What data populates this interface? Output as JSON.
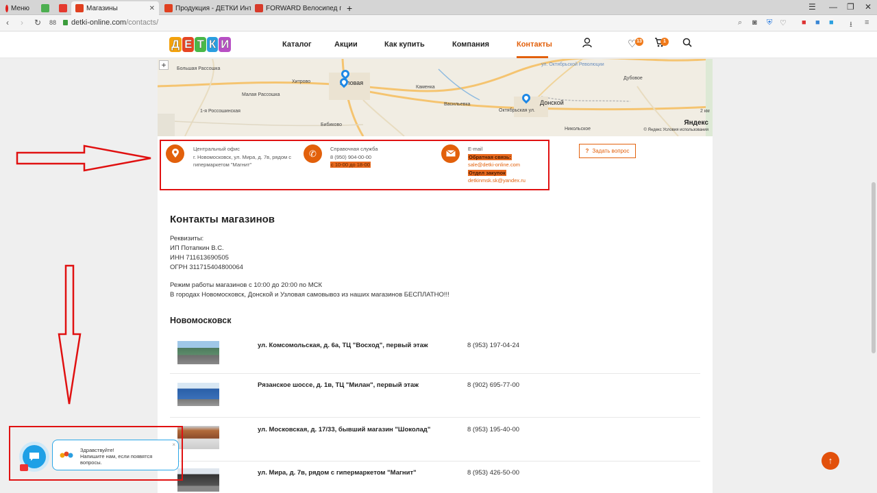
{
  "browser": {
    "tabs": [
      {
        "label": "Меню"
      },
      {
        "label": ""
      },
      {
        "label": ""
      },
      {
        "label": "Магазины"
      },
      {
        "label": "Продукция - ДЕТКИ Интер"
      },
      {
        "label": "FORWARD Велосипед горн"
      }
    ],
    "new_tab": "+",
    "url_host": "detki-online.com",
    "url_path": "/contacts/",
    "speed_dial": "88"
  },
  "header": {
    "logo": [
      "Д",
      "Е",
      "Т",
      "К",
      "И"
    ],
    "logo_colors": [
      "#f4a20c",
      "#e64523",
      "#49b848",
      "#2a9ee0",
      "#b74fc4"
    ],
    "menu": [
      "Каталог",
      "Акции",
      "Как купить",
      "Компания",
      "Контакты"
    ],
    "favorites_count": "13",
    "cart_count": "1"
  },
  "map": {
    "labels": [
      "Большая Рассошка",
      "Хитрово",
      "Малая Рассошка",
      "1-я Россошинская",
      "Бибиково",
      "Узловая",
      "Каменка",
      "Васильевка",
      "Октябрьская ул.",
      "Донской",
      "Дубовое",
      "Никольское",
      "ул. Октябрьской Революции",
      "2 км"
    ],
    "yandex": "Яндекс",
    "copyright": "© Яндекс  Условия использования",
    "zoom_plus": "+"
  },
  "contacts": {
    "office_title": "Центральный офис",
    "office_addr": "г. Новомосковск, ул. Мира, д. 7в, рядом с гипермаркетом \"Магнит\"",
    "help_title": "Справочная служба",
    "help_phone": "8 (950) 904-00-00",
    "help_hours": "с 10-00 до 18-00",
    "email_title": "E-mail",
    "feedback_label": "Обратная связь:",
    "feedback_email": "sale@detki-online.com",
    "purchase_label": "Отдел закупок",
    "purchase_email": "detkinmsk.sk@yandex.ru",
    "ask_button": "Задать вопрос",
    "ask_icon": "?"
  },
  "content": {
    "title": "Контакты магазинов",
    "requisites": [
      "Реквизиты:",
      "ИП Потапкин В.С.",
      "ИНН 711613690505",
      "ОГРН 311715404800064"
    ],
    "schedule": [
      "Режим работы магазинов с 10:00 до 20:00 по МСК",
      "В городах Новомосковск, Донской и Узловая самовывоз из наших магазинов БЕСПЛАТНО!!!"
    ],
    "city": "Новомосковск",
    "stores": [
      {
        "address": "ул. Комсомольская, д. 6а, ТЦ \"Восход\", первый этаж",
        "phone": "8 (953) 197-04-24"
      },
      {
        "address": "Рязанское шоссе, д. 1в, ТЦ \"Милан\", первый этаж",
        "phone": "8 (902) 695-77-00"
      },
      {
        "address": "ул. Московская, д. 17/33, бывший магазин \"Шоколад\"",
        "phone": "8 (953) 195-40-00"
      },
      {
        "address": "ул. Мира, д. 7в, рядом с гипермаркетом \"Магнит\"",
        "phone": "8 (953) 426-50-00"
      }
    ]
  },
  "chat": {
    "greeting": "Здравствуйте!",
    "line1": "Напишите нам, если появятся",
    "line2": "вопросы.",
    "close": "×"
  },
  "colors": {
    "accent": "#e2600b",
    "annotation": "#e01010",
    "chat": "#1ea0e6"
  }
}
